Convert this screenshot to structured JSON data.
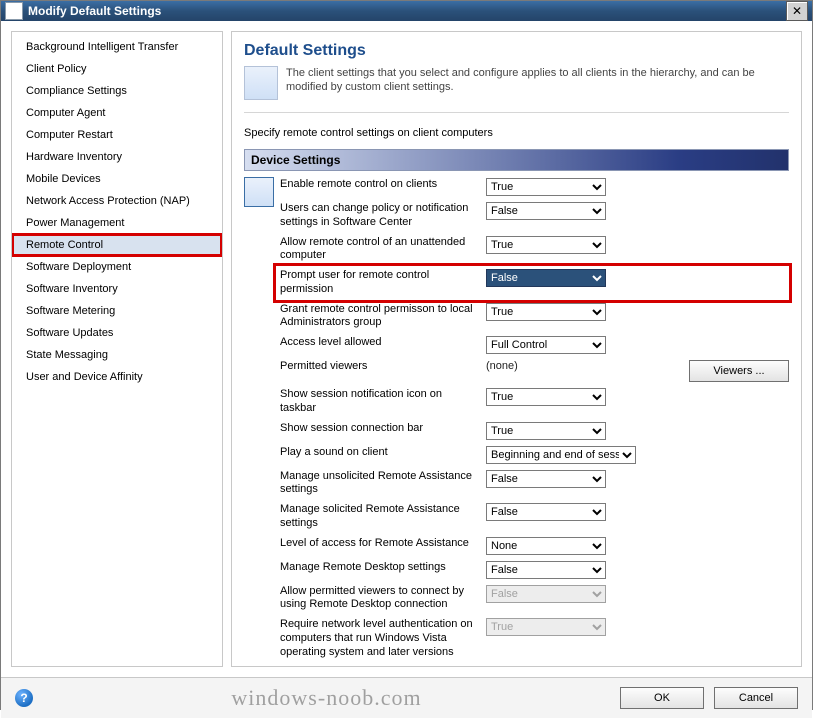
{
  "window": {
    "title": "Modify Default Settings",
    "close_label": "✕"
  },
  "sidebar": {
    "items": [
      {
        "label": "Background Intelligent Transfer"
      },
      {
        "label": "Client Policy"
      },
      {
        "label": "Compliance Settings"
      },
      {
        "label": "Computer Agent"
      },
      {
        "label": "Computer Restart"
      },
      {
        "label": "Hardware Inventory"
      },
      {
        "label": "Mobile Devices"
      },
      {
        "label": "Network Access Protection (NAP)"
      },
      {
        "label": "Power Management"
      },
      {
        "label": "Remote Control"
      },
      {
        "label": "Software Deployment"
      },
      {
        "label": "Software Inventory"
      },
      {
        "label": "Software Metering"
      },
      {
        "label": "Software Updates"
      },
      {
        "label": "State Messaging"
      },
      {
        "label": "User and Device Affinity"
      }
    ],
    "selected_index": 9,
    "highlighted_index": 9
  },
  "content": {
    "heading": "Default Settings",
    "description": "The client settings that you select and configure applies to all clients in the hierarchy, and can be modified by custom client settings.",
    "instruction": "Specify remote control settings on client computers",
    "section_title": "Device Settings",
    "settings": [
      {
        "label": "Enable remote control on clients",
        "value": "True",
        "type": "select"
      },
      {
        "label": "Users can change policy or notification settings in Software Center",
        "value": "False",
        "type": "select"
      },
      {
        "label": "Allow remote control of an unattended computer",
        "value": "True",
        "type": "select"
      },
      {
        "label": "Prompt user for remote control permission",
        "value": "False",
        "type": "select",
        "highlighted": true
      },
      {
        "label": "Grant remote control permisson to local Administrators group",
        "value": "True",
        "type": "select"
      },
      {
        "label": "Access level allowed",
        "value": "Full Control",
        "type": "select"
      },
      {
        "label": "Permitted viewers",
        "value": "(none)",
        "type": "static",
        "button": "Viewers ..."
      },
      {
        "label": "Show session notification icon on taskbar",
        "value": "True",
        "type": "select"
      },
      {
        "label": "Show session connection bar",
        "value": "True",
        "type": "select"
      },
      {
        "label": "Play a sound on client",
        "value": "Beginning and end of session",
        "type": "select",
        "wide": true
      },
      {
        "label": "Manage unsolicited Remote Assistance settings",
        "value": "False",
        "type": "select"
      },
      {
        "label": "Manage solicited Remote Assistance settings",
        "value": "False",
        "type": "select"
      },
      {
        "label": "Level of access for Remote Assistance",
        "value": "None",
        "type": "select"
      },
      {
        "label": "Manage Remote Desktop settings",
        "value": "False",
        "type": "select"
      },
      {
        "label": "Allow permitted viewers to connect by using Remote Desktop connection",
        "value": "False",
        "type": "select",
        "disabled": true
      },
      {
        "label": "Require network level authentication on computers that run Windows Vista operating system and later versions",
        "value": "True",
        "type": "select",
        "disabled": true
      }
    ]
  },
  "footer": {
    "help_tooltip": "Help",
    "watermark": "windows-noob.com",
    "ok_label": "OK",
    "cancel_label": "Cancel"
  }
}
